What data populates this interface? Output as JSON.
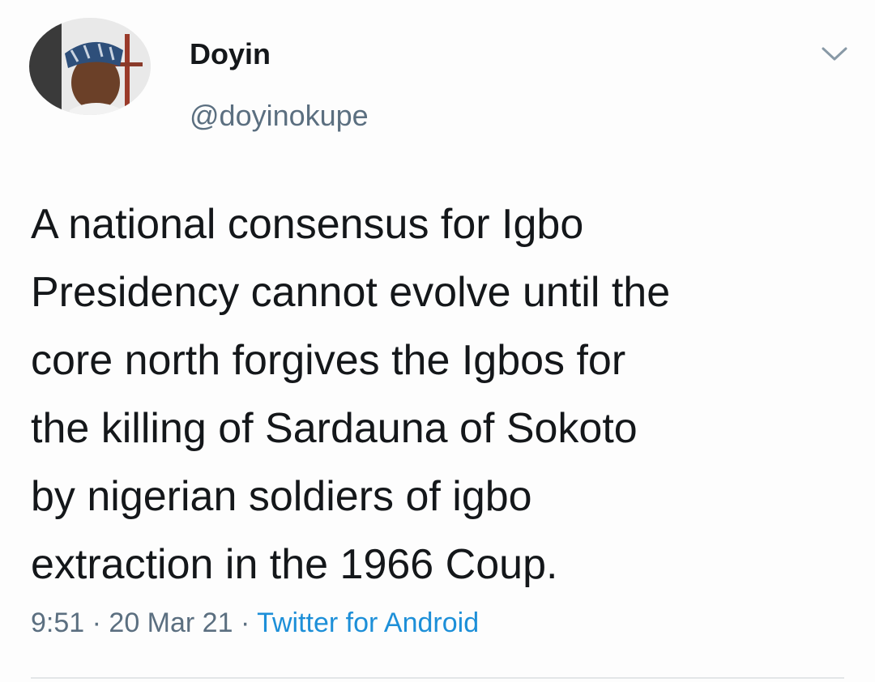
{
  "author": {
    "display_name": "Doyin",
    "handle": "@doyinokupe"
  },
  "tweet": {
    "text": "A national consensus for Igbo\nPresidency cannot evolve until the\ncore north forgives the Igbos for\nthe killing of Sardauna of Sokoto\nby nigerian soldiers of igbo\nextraction in the 1966 Coup.",
    "time": "9:51",
    "separator": " · ",
    "date": "20 Mar 21",
    "source": "Twitter for Android"
  },
  "icons": {
    "menu": "chevron-down-icon",
    "avatar": "avatar"
  },
  "colors": {
    "text": "#14171a",
    "secondary": "#5b6f80",
    "link": "#1d8fd8"
  }
}
